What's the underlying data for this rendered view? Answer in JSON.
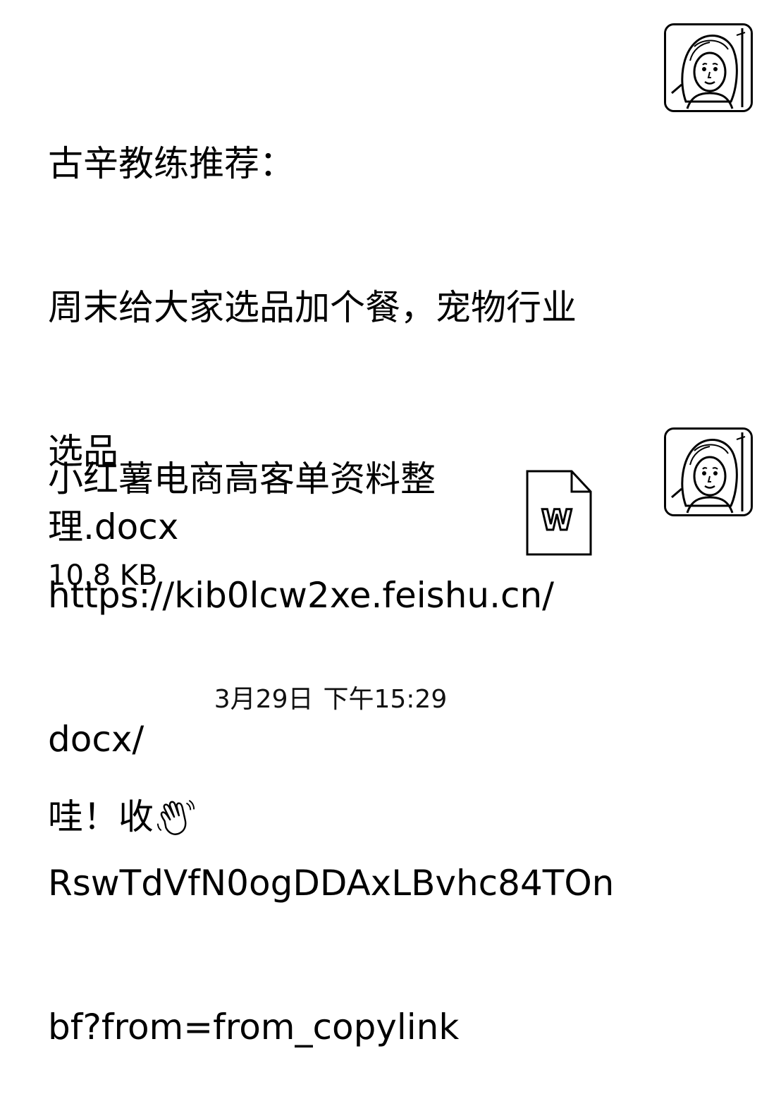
{
  "messages": {
    "recommend": {
      "lines": [
        "古辛教练推荐：",
        "周末给大家选品加个餐，宠物行业",
        "选品",
        "https://kib0lcw2xe.feishu.cn/",
        "docx/",
        "RswTdVfN0ogDDAxLBvhc84TOn",
        "bf?from=from_copylink"
      ]
    },
    "file": {
      "name_line1": "小红薯电商高客单资料整",
      "name_line2": "理.docx",
      "size": "10.8 KB",
      "icon": "word-document-icon",
      "icon_letter": "W"
    },
    "timestamp": {
      "date": "3月29日",
      "time": "下午15:29"
    },
    "reply": {
      "text": "哇！收",
      "icon": "waving-hand-icon"
    }
  },
  "avatars": {
    "icon": "user-avatar-icon"
  }
}
